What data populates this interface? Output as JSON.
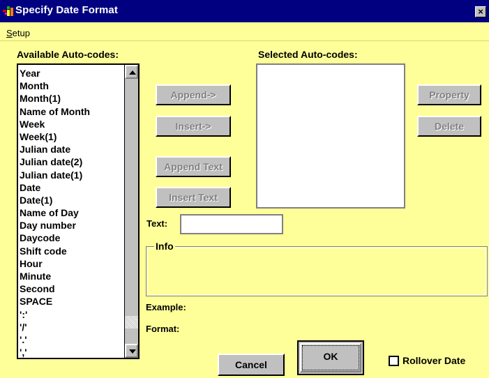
{
  "window": {
    "title": "Specify Date Format",
    "close_glyph": "×"
  },
  "menu": {
    "setup_first": "S",
    "setup_rest": "etup"
  },
  "available": {
    "label": "Available Auto-codes:",
    "items": [
      "Year",
      "Month",
      "Month(1)",
      "Name of Month",
      "Week",
      "Week(1)",
      "Julian date",
      "Julian date(2)",
      "Julian date(1)",
      "Date",
      "Date(1)",
      "Name of Day",
      "Day number",
      "Daycode",
      "Shift code",
      "Hour",
      "Minute",
      "Second",
      "SPACE",
      "':'",
      "'/'",
      "'.'",
      "','",
      "'-'"
    ]
  },
  "selected": {
    "label": "Selected Auto-codes:"
  },
  "buttons": {
    "append": "Append->",
    "insert": "Insert->",
    "append_text": "Append Text",
    "insert_text": "Insert Text",
    "property": "Property",
    "delete": "Delete",
    "cancel": "Cancel",
    "ok": "OK"
  },
  "text_field": {
    "label": "Text:",
    "value": ""
  },
  "info": {
    "label": "Info"
  },
  "example": {
    "label": "Example:"
  },
  "format": {
    "label": "Format:"
  },
  "rollover": {
    "label": "Rollover Date",
    "checked": false
  },
  "colors": {
    "background": "#ffff99",
    "titlebar": "#000080",
    "button_face": "#c0c0c0"
  },
  "icons": [
    "app-icon",
    "close-icon",
    "scroll-up-icon",
    "scroll-down-icon"
  ]
}
